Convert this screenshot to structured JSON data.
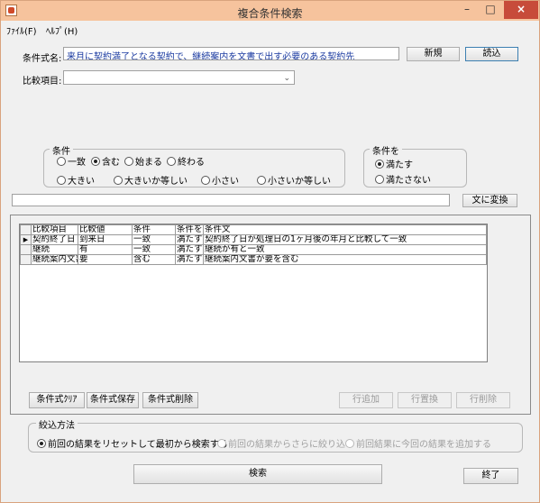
{
  "window": {
    "title": "複合条件検索",
    "min_glyph": "–",
    "max_glyph": "□",
    "close_glyph": "×"
  },
  "menu": [
    {
      "label": "ﾌｧｲﾙ(F)"
    },
    {
      "label": "ﾍﾙﾌﾟ(H)"
    }
  ],
  "condition_name": {
    "label": "条件式名:",
    "value": "来月に契約満了となる契約で、継続案内を文書で出す必要のある契約先",
    "new_button": "新規",
    "load_button": "読込"
  },
  "comparison_item": {
    "label": "比較項目:",
    "value": ""
  },
  "condition_group": {
    "title": "条件",
    "options": [
      {
        "label": "一致",
        "selected": false
      },
      {
        "label": "含む",
        "selected": true
      },
      {
        "label": "始まる",
        "selected": false
      },
      {
        "label": "終わる",
        "selected": false
      },
      {
        "label": "大きい",
        "selected": false
      },
      {
        "label": "大きいか等しい",
        "selected": false
      },
      {
        "label": "小さい",
        "selected": false
      },
      {
        "label": "小さいか等しい",
        "selected": false
      }
    ]
  },
  "condition_mode_group": {
    "title": "条件を",
    "options": [
      {
        "label": "満たす",
        "selected": true
      },
      {
        "label": "満たさない",
        "selected": false
      }
    ]
  },
  "value_input": {
    "value": ""
  },
  "to_text_button": "文に変換",
  "grid": {
    "columns": [
      "比較項目",
      "比較値",
      "条件",
      "条件を",
      "条件文"
    ],
    "rows": [
      {
        "current": true,
        "cells": [
          "契約終了日",
          "到来日",
          "一致",
          "満たす",
          "契約終了日が処理日の1ヶ月後の年月と比較して一致"
        ]
      },
      {
        "current": false,
        "cells": [
          "継続",
          "有",
          "一致",
          "満たす",
          "継続が有と一致"
        ]
      },
      {
        "current": false,
        "cells": [
          "継続案内文書",
          "要",
          "含む",
          "満たす",
          "継続案内文書が要を含む"
        ]
      }
    ]
  },
  "panel_buttons": {
    "clear": "条件式ｸﾘｱ",
    "save": "条件式保存",
    "delete": "条件式削除",
    "add_row": "行追加",
    "replace_row": "行置換",
    "delete_row": "行削除"
  },
  "narrowing": {
    "title": "絞込方法",
    "options": [
      {
        "label": "前回の結果をリセットして最初から検索する",
        "selected": true,
        "enabled": true
      },
      {
        "label": "前回の結果からさらに絞り込む",
        "selected": false,
        "enabled": false
      },
      {
        "label": "前回結果に今回の結果を追加する",
        "selected": false,
        "enabled": false
      }
    ]
  },
  "search_button": "検索",
  "exit_button": "終了"
}
